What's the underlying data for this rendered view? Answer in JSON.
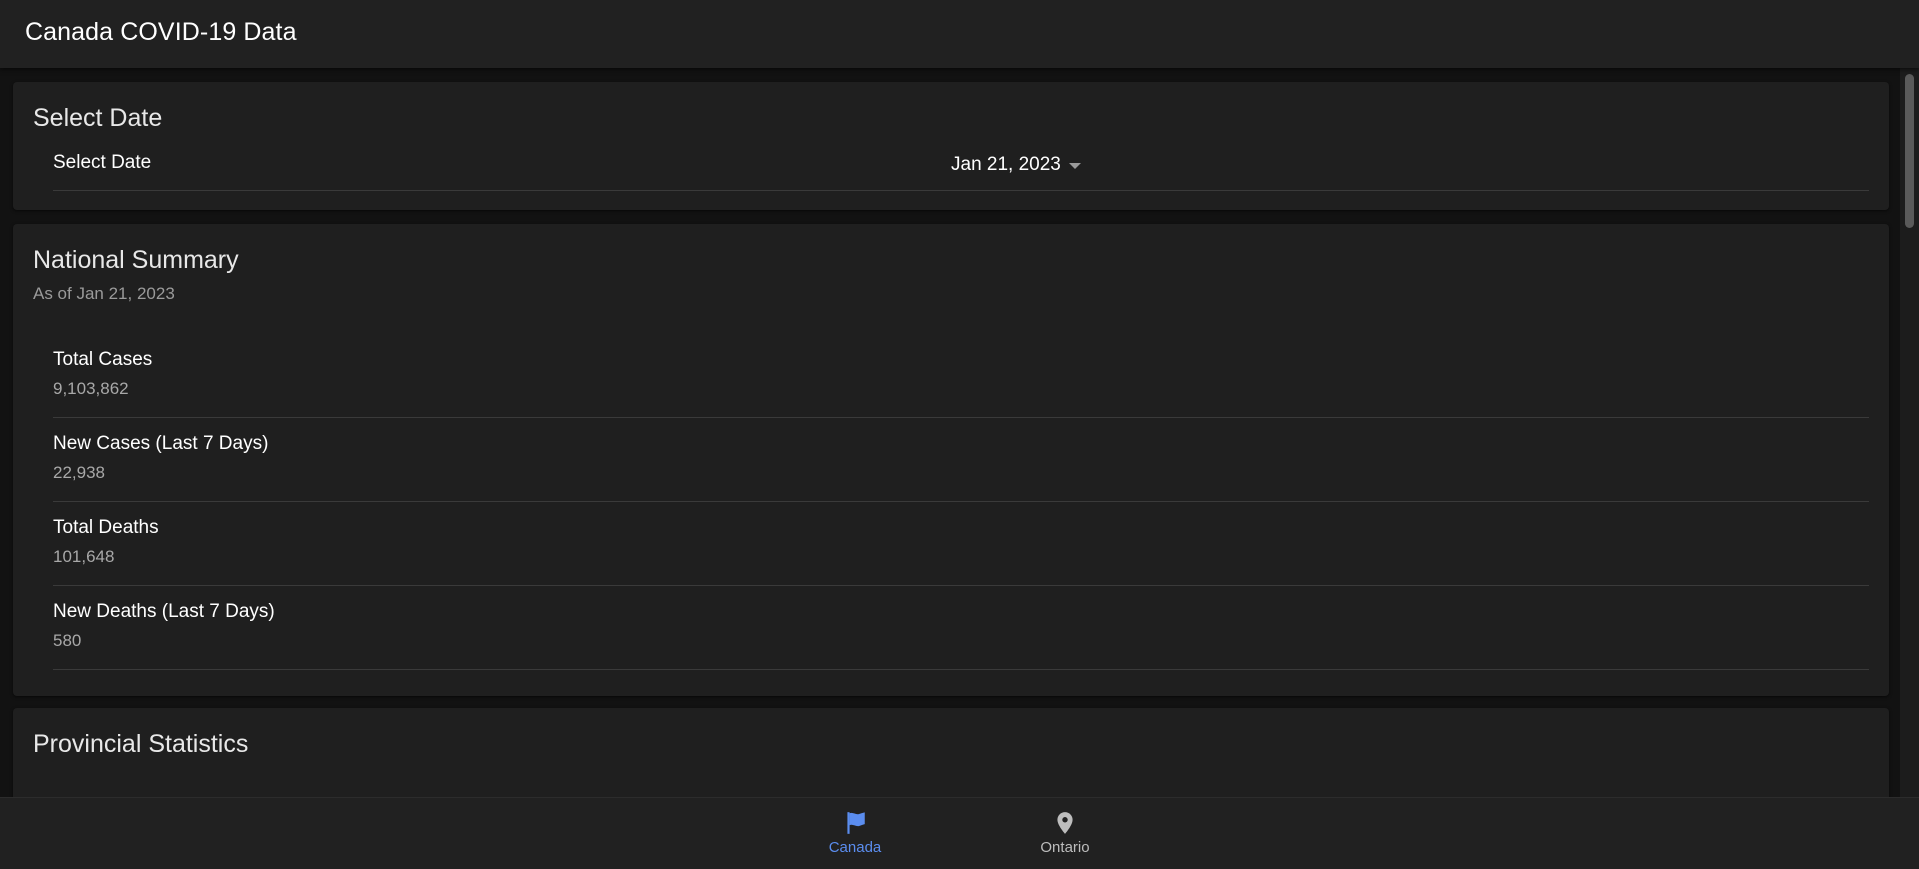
{
  "header": {
    "title": "Canada COVID-19 Data"
  },
  "date_card": {
    "title": "Select Date",
    "label": "Select Date",
    "selected_date": "Jan 21, 2023"
  },
  "summary": {
    "title": "National Summary",
    "subtitle": "As of Jan 21, 2023",
    "items": [
      {
        "label": "Total Cases",
        "value": "9,103,862"
      },
      {
        "label": "New Cases (Last 7 Days)",
        "value": "22,938"
      },
      {
        "label": "Total Deaths",
        "value": "101,648"
      },
      {
        "label": "New Deaths (Last 7 Days)",
        "value": "580"
      }
    ]
  },
  "provincial": {
    "title": "Provincial Statistics"
  },
  "bottom_nav": {
    "items": [
      {
        "label": "Canada",
        "icon": "flag-icon",
        "active": true
      },
      {
        "label": "Ontario",
        "icon": "map-marker-icon",
        "active": false
      }
    ]
  },
  "colors": {
    "active_nav": "#5b8def",
    "inactive_nav": "#bdbdbd",
    "background": "#121212",
    "surface": "#1f1f1f"
  }
}
